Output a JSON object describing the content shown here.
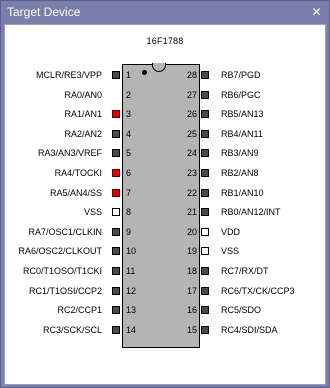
{
  "window": {
    "title": "Target Device",
    "close_glyph": "✕"
  },
  "chip": {
    "name": "16F1788"
  },
  "pins_left": [
    {
      "num": "1",
      "label": "MCLR/RE3/VPP",
      "state": "dark"
    },
    {
      "num": "2",
      "label": "RA0/AN0",
      "state": "none"
    },
    {
      "num": "3",
      "label": "RA1/AN1",
      "state": "red"
    },
    {
      "num": "4",
      "label": "RA2/AN2",
      "state": "dark"
    },
    {
      "num": "5",
      "label": "RA3/AN3/VREF",
      "state": "dark"
    },
    {
      "num": "6",
      "label": "RA4/TOCKI",
      "state": "red"
    },
    {
      "num": "7",
      "label": "RA5/AN4/SS",
      "state": "red"
    },
    {
      "num": "8",
      "label": "VSS",
      "state": "white"
    },
    {
      "num": "9",
      "label": "RA7/OSC1/CLKIN",
      "state": "dark"
    },
    {
      "num": "10",
      "label": "RA6/OSC2/CLKOUT",
      "state": "dark"
    },
    {
      "num": "11",
      "label": "RC0/T1OSO/T1CKI",
      "state": "dark"
    },
    {
      "num": "12",
      "label": "RC1/T1OSI/CCP2",
      "state": "dark"
    },
    {
      "num": "13",
      "label": "RC2/CCP1",
      "state": "dark"
    },
    {
      "num": "14",
      "label": "RC3/SCK/SCL",
      "state": "dark"
    }
  ],
  "pins_right": [
    {
      "num": "28",
      "label": "RB7/PGD",
      "state": "dark"
    },
    {
      "num": "27",
      "label": "RB6/PGC",
      "state": "dark"
    },
    {
      "num": "26",
      "label": "RB5/AN13",
      "state": "dark"
    },
    {
      "num": "25",
      "label": "RB4/AN11",
      "state": "dark"
    },
    {
      "num": "24",
      "label": "RB3/AN9",
      "state": "dark"
    },
    {
      "num": "23",
      "label": "RB2/AN8",
      "state": "dark"
    },
    {
      "num": "22",
      "label": "RB1/AN10",
      "state": "dark"
    },
    {
      "num": "21",
      "label": "RB0/AN12/INT",
      "state": "dark"
    },
    {
      "num": "20",
      "label": "VDD",
      "state": "white"
    },
    {
      "num": "19",
      "label": "VSS",
      "state": "white"
    },
    {
      "num": "18",
      "label": "RC7/RX/DT",
      "state": "dark"
    },
    {
      "num": "17",
      "label": "RC6/TX/CK/CCP3",
      "state": "dark"
    },
    {
      "num": "16",
      "label": "RC5/SDO",
      "state": "dark"
    },
    {
      "num": "15",
      "label": "RC4/SDI/SDA",
      "state": "dark"
    }
  ]
}
